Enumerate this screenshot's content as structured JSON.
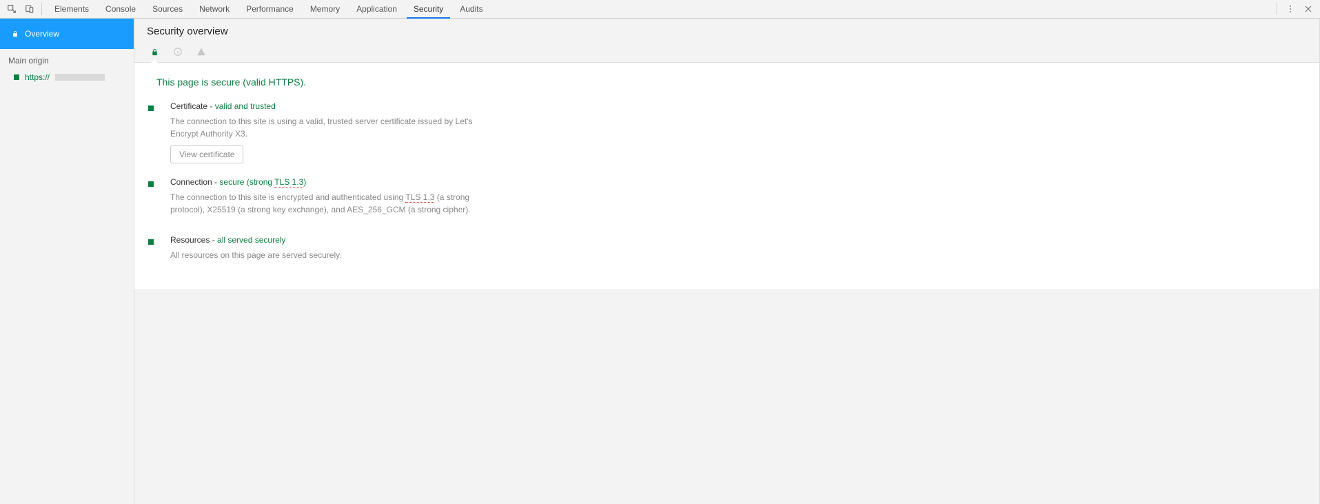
{
  "toolbar": {
    "tabs": [
      "Elements",
      "Console",
      "Sources",
      "Network",
      "Performance",
      "Memory",
      "Application",
      "Security",
      "Audits"
    ],
    "active_tab": "Security"
  },
  "sidebar": {
    "overview_label": "Overview",
    "section_label": "Main origin",
    "origin_prefix": "https://"
  },
  "main": {
    "title": "Security overview",
    "banner": "This page is secure (valid HTTPS).",
    "cert": {
      "title_pre": "Certificate",
      "title_dash": " - ",
      "title_status": "valid and trusted",
      "desc": "The connection to this site is using a valid, trusted server certificate issued by Let's Encrypt Authority X3.",
      "button": "View certificate"
    },
    "conn": {
      "title_pre": "Connection",
      "title_dash": " - ",
      "title_status_a": "secure (strong ",
      "title_status_tls": "TLS 1.3",
      "title_status_b": ")",
      "desc_a": "The connection to this site is encrypted and authenticated using ",
      "desc_tls": "TLS 1.3",
      "desc_b": " (a strong protocol), X25519 (a strong key exchange), and AES_256_GCM (a strong cipher)."
    },
    "res": {
      "title_pre": "Resources",
      "title_dash": " - ",
      "title_status": "all served securely",
      "desc": "All resources on this page are served securely."
    }
  }
}
